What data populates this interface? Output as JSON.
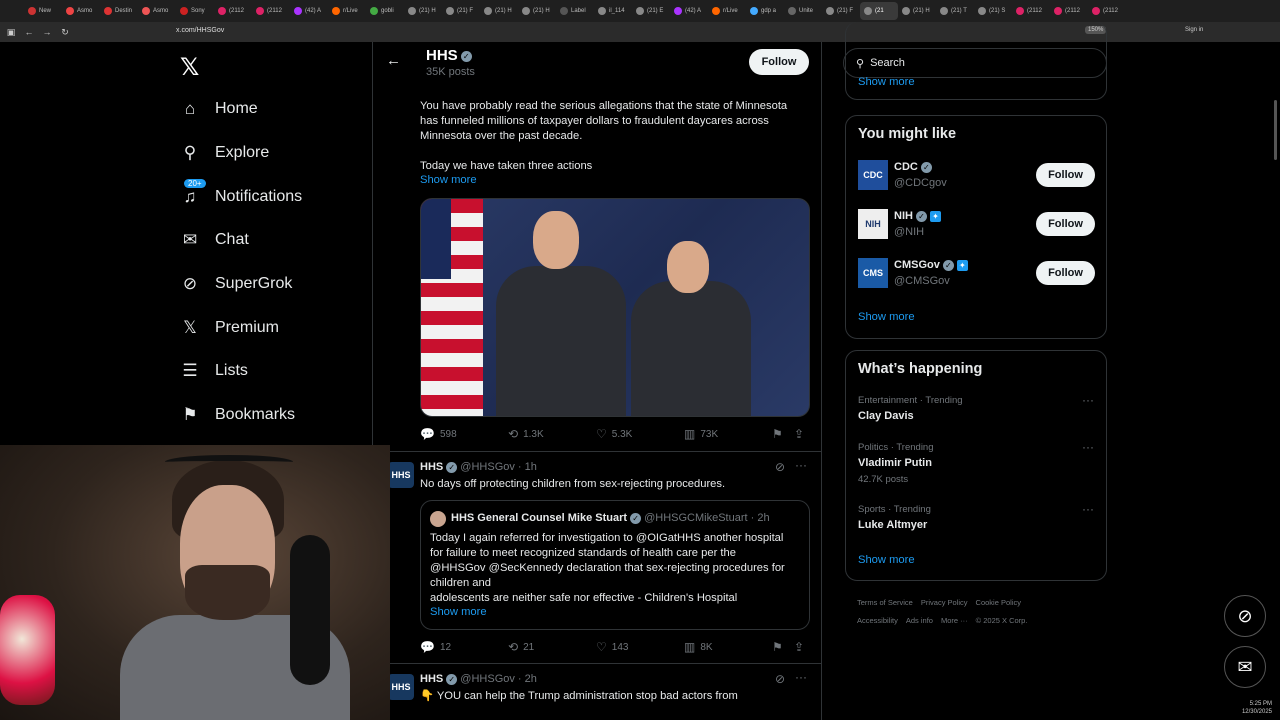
{
  "browser": {
    "tabs": [
      {
        "label": "New"
      },
      {
        "label": "Asmo"
      },
      {
        "label": "Destin"
      },
      {
        "label": "Asmo"
      },
      {
        "label": "Sony"
      },
      {
        "label": "(2112"
      },
      {
        "label": "(2112"
      },
      {
        "label": "(42) A"
      },
      {
        "label": "r/Live"
      },
      {
        "label": "gobli"
      },
      {
        "label": "(21) H"
      },
      {
        "label": "(21) F"
      },
      {
        "label": "(21) H"
      },
      {
        "label": "(21) H"
      },
      {
        "label": "Label"
      },
      {
        "label": "il_114"
      },
      {
        "label": "(21) E"
      },
      {
        "label": "(42) A"
      },
      {
        "label": "r/Live"
      },
      {
        "label": "gdp a"
      },
      {
        "label": "Unite"
      },
      {
        "label": "(21) F"
      },
      {
        "label": "(21"
      },
      {
        "label": "(21) H"
      },
      {
        "label": "(21) T"
      },
      {
        "label": "(21) S"
      },
      {
        "label": "(2112"
      },
      {
        "label": "(2112"
      },
      {
        "label": "(2112"
      }
    ],
    "active_tab_index": 22,
    "url": "x.com/HHSGov",
    "zoom": "150%",
    "sign_in": "Sign in"
  },
  "left_nav": {
    "items": [
      {
        "label": "Home",
        "icon": "home-icon",
        "glyph": "⌂"
      },
      {
        "label": "Explore",
        "icon": "search-icon",
        "glyph": "⚲"
      },
      {
        "label": "Notifications",
        "icon": "bell-icon",
        "glyph": "♫",
        "badge": "20+"
      },
      {
        "label": "Chat",
        "icon": "mail-icon",
        "glyph": "✉"
      },
      {
        "label": "SuperGrok",
        "icon": "grok-icon",
        "glyph": "⊘"
      },
      {
        "label": "Premium",
        "icon": "x-logo-icon",
        "glyph": "𝕏"
      },
      {
        "label": "Lists",
        "icon": "list-icon",
        "glyph": "☰"
      },
      {
        "label": "Bookmarks",
        "icon": "bookmark-icon",
        "glyph": "⚑"
      }
    ]
  },
  "profile_header": {
    "name": "HHS",
    "posts": "35K posts",
    "follow_label": "Follow"
  },
  "tweets": [
    {
      "text_lines": [
        "You have probably read the serious allegations that the state of Minnesota",
        "has funneled millions of taxpayer dollars to fraudulent daycares across",
        "Minnesota over the past decade."
      ],
      "text_line2": "Today we have taken three actions",
      "show_more": "Show more",
      "stats": {
        "replies": "598",
        "reposts": "1.3K",
        "likes": "5.3K",
        "views": "73K"
      }
    },
    {
      "author": "HHS",
      "handle": "@HHSGov · 1h",
      "text": "No days off protecting children from sex-rejecting procedures.",
      "quote": {
        "author": "HHS General Counsel Mike Stuart",
        "handle": "@HHSGCMikeStuart · 2h",
        "text_lines": [
          "Today I again referred for investigation to @OIGatHHS another hospital",
          "for failure to meet recognized standards of health care per the",
          "@HHSGov @SecKennedy declaration that sex-rejecting procedures for",
          "children and",
          "adolescents are neither safe nor effective - Children's Hospital"
        ],
        "show_more": "Show more"
      },
      "stats": {
        "replies": "12",
        "reposts": "21",
        "likes": "143",
        "views": "8K"
      }
    },
    {
      "author": "HHS",
      "handle": "@HHSGov · 2h",
      "text": "👇 YOU can help the Trump administration stop bad actors from"
    }
  ],
  "sidebar": {
    "search_placeholder": "Search",
    "top_show_more": "Show more",
    "suggest_title": "You might like",
    "suggestions": [
      {
        "name": "CDC",
        "handle": "@CDCgov",
        "avatar": "CDC",
        "follow": "Follow",
        "badge_color": "#829aab"
      },
      {
        "name": "NIH",
        "handle": "@NIH",
        "avatar": "NIH",
        "follow": "Follow",
        "badge_color": "#829aab"
      },
      {
        "name": "CMSGov",
        "handle": "@CMSGov",
        "avatar": "CMS",
        "follow": "Follow",
        "badge_color": "#829aab"
      }
    ],
    "suggest_show_more": "Show more",
    "happening_title": "What’s happening",
    "trends": [
      {
        "category": "Entertainment · Trending",
        "name": "Clay Davis",
        "count": ""
      },
      {
        "category": "Politics · Trending",
        "name": "Vladimir Putin",
        "count": "42.7K posts"
      },
      {
        "category": "Sports · Trending",
        "name": "Luke Altmyer",
        "count": ""
      }
    ],
    "happening_show_more": "Show more",
    "footer": [
      "Terms of Service",
      "Privacy Policy",
      "Cookie Policy",
      "Accessibility",
      "Ads info",
      "More ···",
      "© 2025 X Corp."
    ]
  },
  "system": {
    "time": "5:25 PM",
    "date": "12/30/2025"
  },
  "colors": {
    "accent": "#1d9bf0",
    "text": "#e7e9ea",
    "muted": "#71767b",
    "border": "#2f3336"
  }
}
